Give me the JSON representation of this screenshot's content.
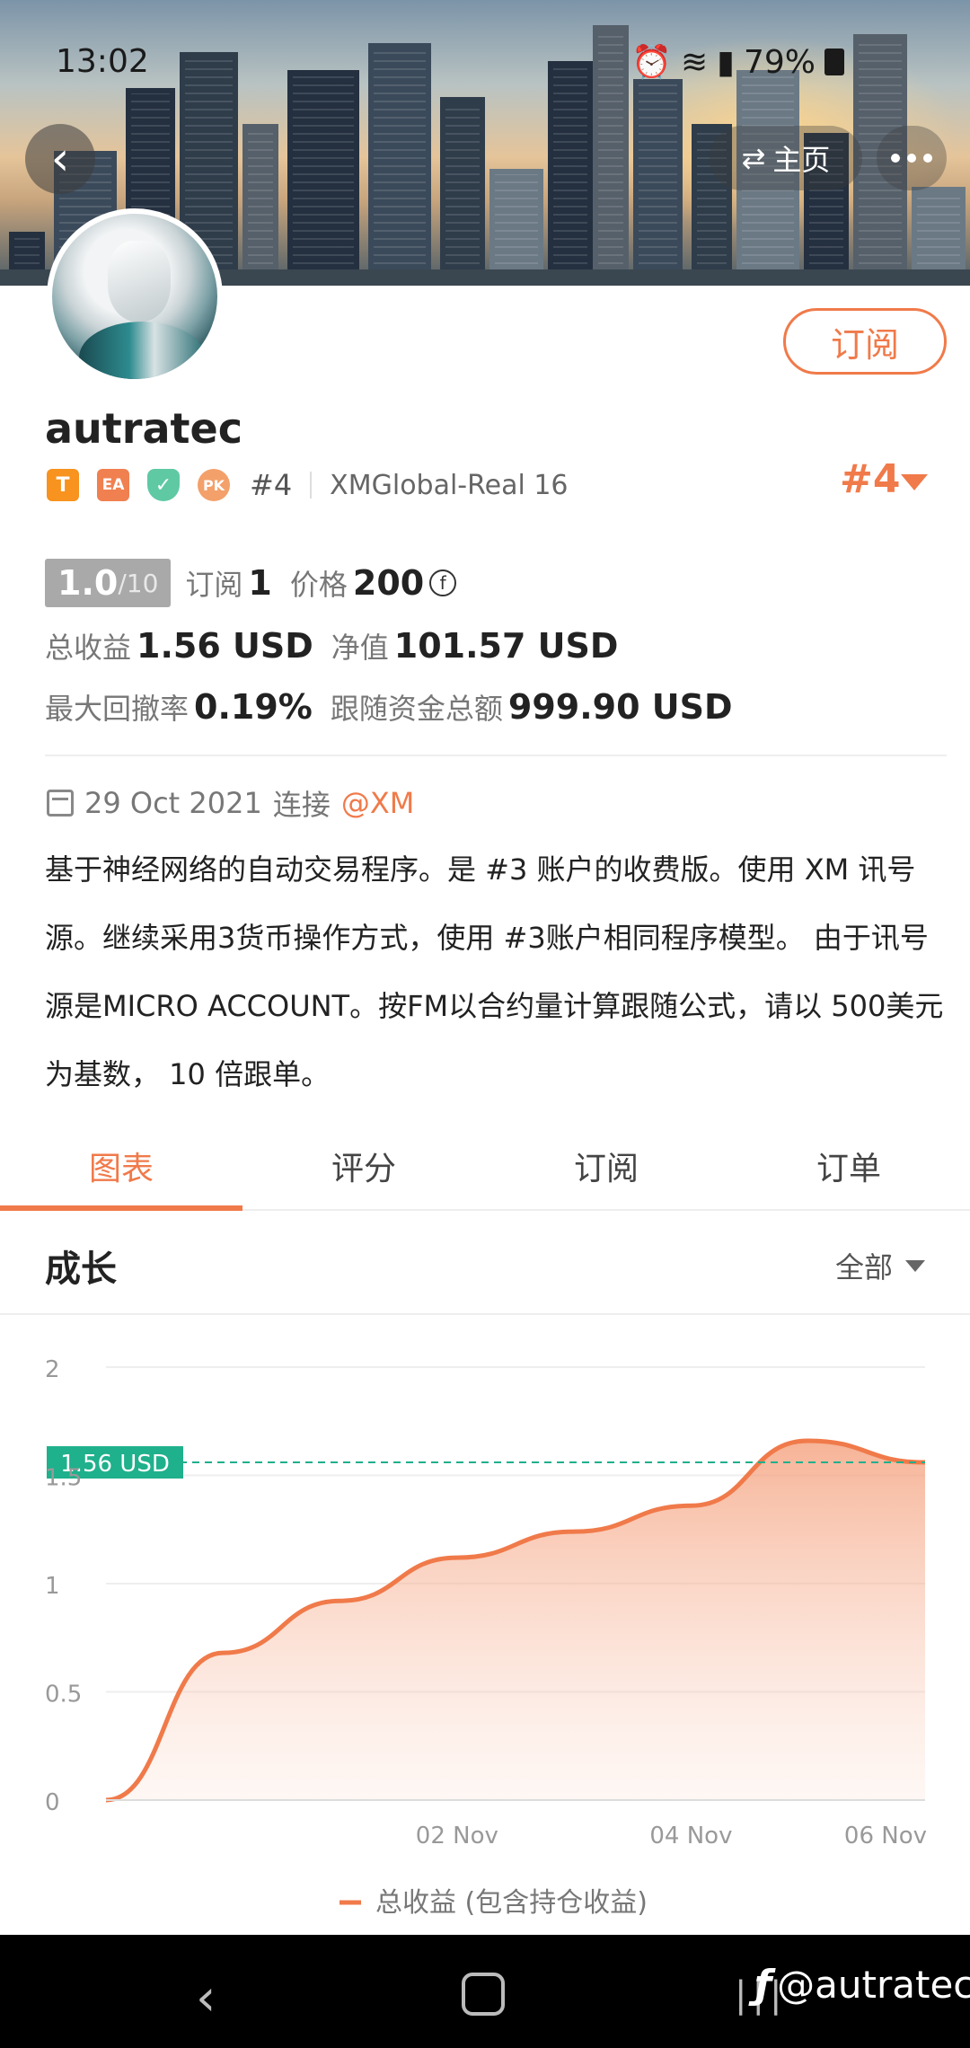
{
  "status_bar": {
    "time": "13:02",
    "battery": "79%"
  },
  "header": {
    "home_label": "主页",
    "back_icon": "chevron-left-icon",
    "more_icon": "more-dots-icon"
  },
  "profile": {
    "subscribe_label": "订阅",
    "username": "autratec",
    "badges": {
      "t": "T",
      "ea": "EA",
      "pk": "PK"
    },
    "rank_small": "#4",
    "server": "XMGlobal-Real 16",
    "rank_big": "#4"
  },
  "stats": {
    "score": "1.0",
    "score_max": "/10",
    "subscribers_label": "订阅",
    "subscribers": "1",
    "price_label": "价格",
    "price": "200",
    "total_profit_label": "总收益",
    "total_profit": "1.56 USD",
    "equity_label": "净值",
    "equity": "101.57 USD",
    "max_drawdown_label": "最大回撤率",
    "max_drawdown": "0.19%",
    "follow_funds_label": "跟随资金总额",
    "follow_funds": "999.90 USD"
  },
  "info": {
    "date": "29 Oct 2021",
    "connect_label": "连接",
    "broker": "@XM",
    "description": "基于神经网络的自动交易程序。是 #3 账户的收费版。使用 XM 讯号源。继续采用3货币操作方式，使用 #3账户相同程序模型。 由于讯号源是MICRO ACCOUNT。按FM以合约量计算跟随公式，请以 500美元为基数， 10 倍跟单。"
  },
  "tabs": [
    "图表",
    "评分",
    "订阅",
    "订单"
  ],
  "growth": {
    "title": "成长",
    "range": "全部"
  },
  "chart_data": {
    "type": "area",
    "x": [
      "Oct 30",
      "Oct 31",
      "Nov 1",
      "Nov 2",
      "Nov 3",
      "Nov 4",
      "Nov 5",
      "Nov 6"
    ],
    "series": [
      {
        "name": "总收益 (包含持仓收益)",
        "values": [
          0,
          0.68,
          0.92,
          1.12,
          1.24,
          1.36,
          1.66,
          1.56
        ],
        "color": "#f07a4a"
      }
    ],
    "x_tick_labels": [
      "02 Nov",
      "04 Nov",
      "06 Nov"
    ],
    "y_ticks": [
      "0",
      "0.5",
      "1",
      "1.5",
      "2"
    ],
    "ylim": [
      0,
      2
    ],
    "current_value": 1.56,
    "current_value_label": "1.56 USD",
    "reference_color": "#1fb08c",
    "legend": "总收益 (包含持仓收益)",
    "legend_position": "bottom"
  },
  "watermark": "@autratec"
}
